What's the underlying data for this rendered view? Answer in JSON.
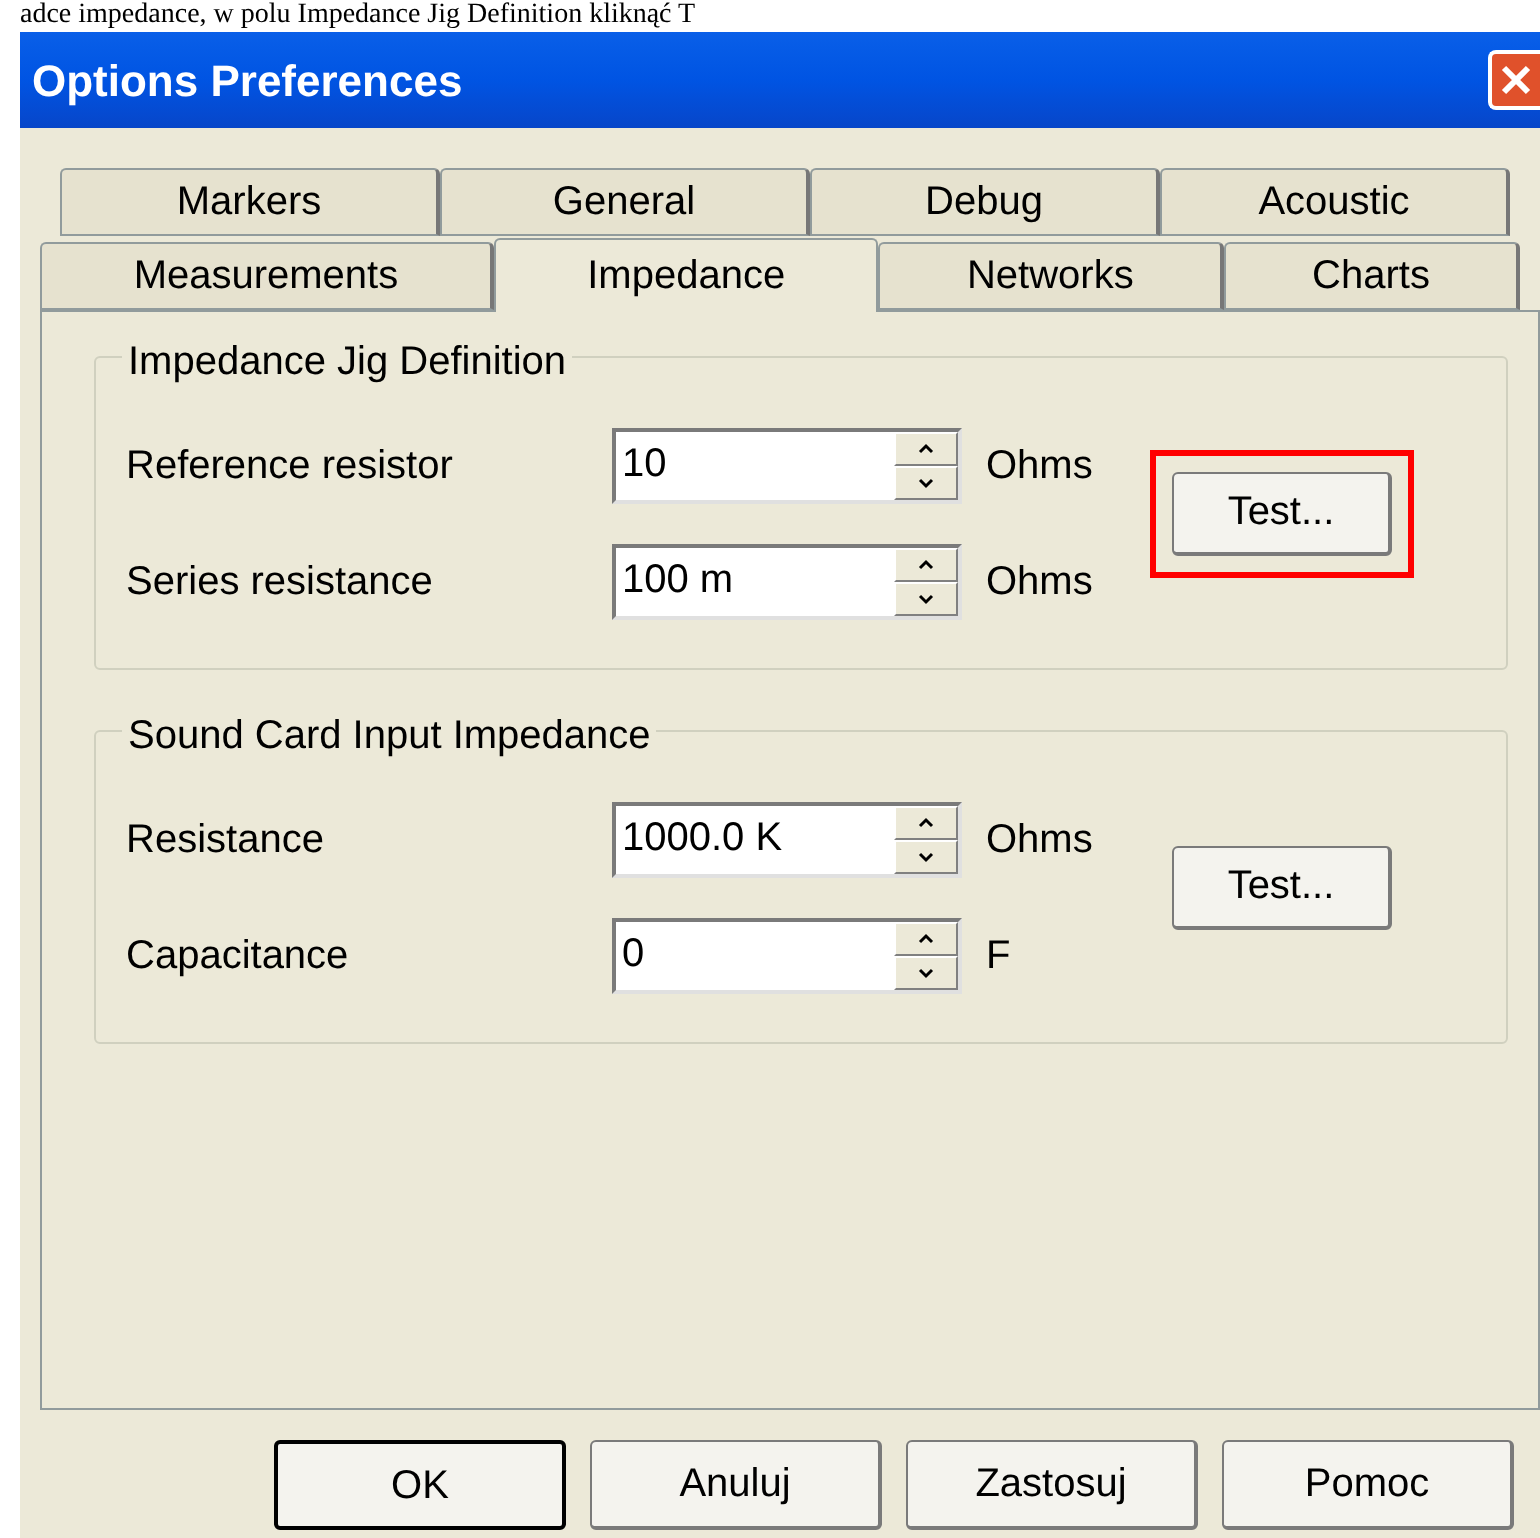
{
  "document_text": "adce impedance, w polu Impedance Jig Definition kliknąć T",
  "window": {
    "title": "Options Preferences"
  },
  "tab_rows": [
    [
      {
        "label": "Markers",
        "selected": false
      },
      {
        "label": "General",
        "selected": false
      },
      {
        "label": "Debug",
        "selected": false
      },
      {
        "label": "Acoustic",
        "selected": false
      }
    ],
    [
      {
        "label": "Measurements",
        "selected": false
      },
      {
        "label": "Impedance",
        "selected": true
      },
      {
        "label": "Networks",
        "selected": false
      },
      {
        "label": "Charts",
        "selected": false
      }
    ]
  ],
  "groups": [
    {
      "title": "Impedance Jig Definition",
      "fields": [
        {
          "label": "Reference resistor",
          "value": "10",
          "unit": "Ohms"
        },
        {
          "label": "Series resistance",
          "value": "100 m",
          "unit": "Ohms"
        }
      ],
      "button": {
        "label": "Test...",
        "highlighted": true
      }
    },
    {
      "title": "Sound Card Input Impedance",
      "fields": [
        {
          "label": "Resistance",
          "value": "1000.0 K",
          "unit": "Ohms"
        },
        {
          "label": "Capacitance",
          "value": "0",
          "unit": "F"
        }
      ],
      "button": {
        "label": "Test...",
        "highlighted": false
      }
    }
  ],
  "buttons": [
    {
      "label": "OK",
      "default": true
    },
    {
      "label": "Anuluj",
      "default": false
    },
    {
      "label": "Zastosuj",
      "default": false
    },
    {
      "label": "Pomoc",
      "default": false
    }
  ]
}
